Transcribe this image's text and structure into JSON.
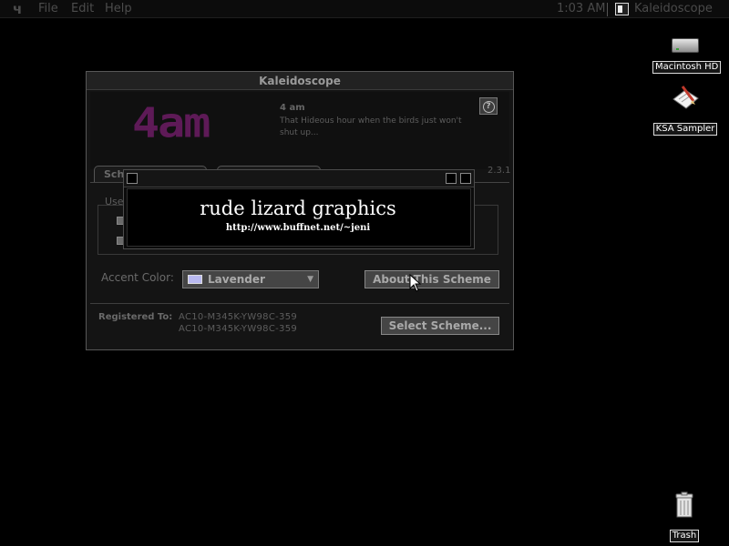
{
  "menubar": {
    "apple_glyph": "ч",
    "menus": [
      "File",
      "Edit",
      "Help"
    ],
    "clock": "1:03 AM",
    "app_name": "Kaleidoscope"
  },
  "desktop": {
    "icons": [
      {
        "label": "Macintosh HD",
        "icon": "hard-drive-icon"
      },
      {
        "label": "KSA Sampler",
        "icon": "document-pen-icon"
      },
      {
        "label": "Trash",
        "icon": "trash-can-icon"
      }
    ]
  },
  "window": {
    "title": "Kaleidoscope",
    "scheme": {
      "logo_text": "4am",
      "name": "4 am",
      "description": "That Hideous hour when the birds just won't shut up...",
      "logo_color": "#5e1a57"
    },
    "help_glyph": "?",
    "tabs": [
      "Sch",
      ""
    ],
    "version": "2.3.1",
    "use_label": "Use",
    "accent": {
      "label": "Accent Color:",
      "value": "Lavender",
      "swatch_color": "#b9b9f0"
    },
    "about_button": "About This Scheme",
    "registered_label": "Registered To:",
    "registered_codes": [
      "AC10-M345K-YW98C-359",
      "AC10-M345K-YW98C-359"
    ],
    "select_button": "Select Scheme..."
  },
  "splash": {
    "title": "rude lizard graphics",
    "url": "http://www.buffnet.net/~jeni"
  }
}
